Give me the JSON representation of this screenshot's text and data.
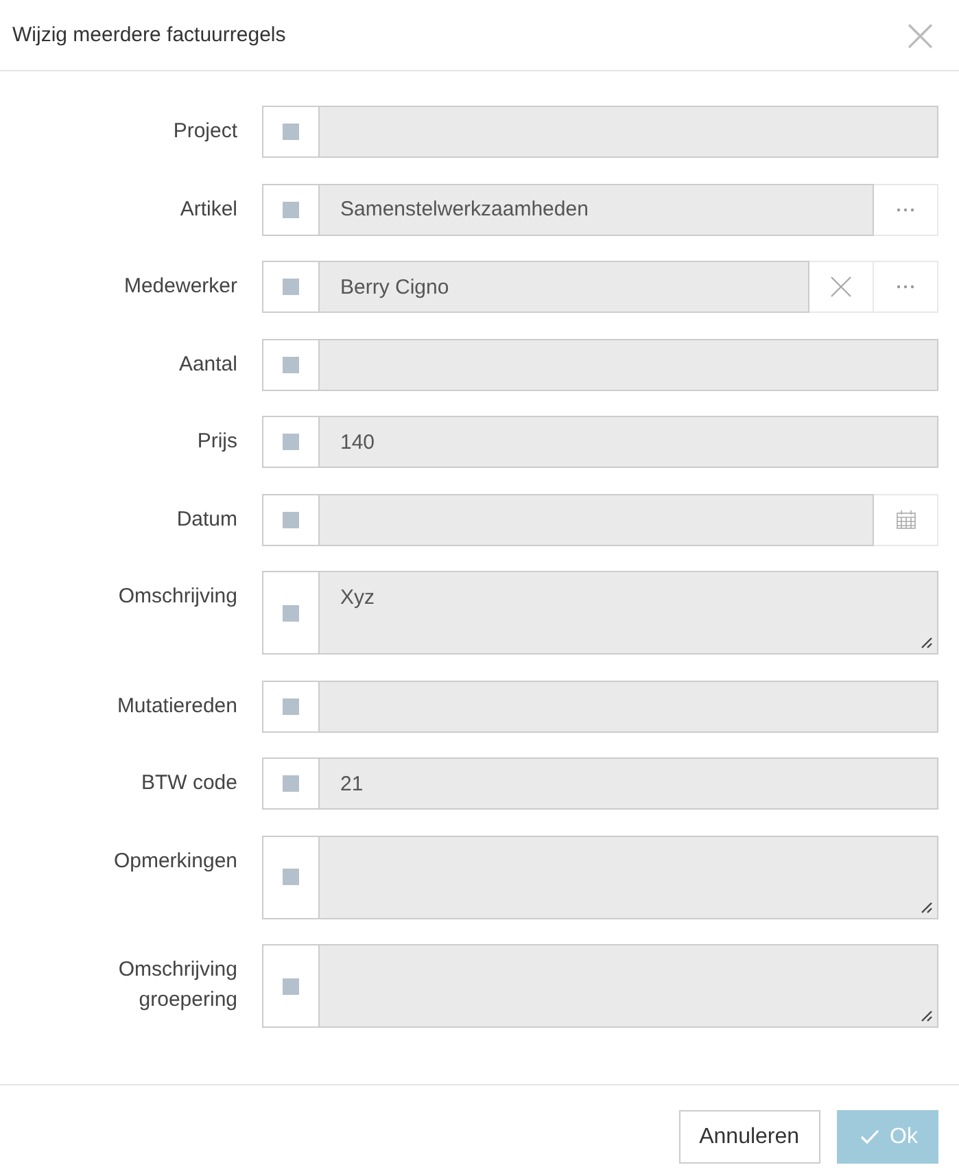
{
  "dialog": {
    "title": "Wijzig meerdere factuurregels",
    "close_symbol": "×"
  },
  "fields": [
    {
      "label": "Project",
      "kind": "text"
    },
    {
      "label": "Artikel",
      "kind": "lookup",
      "value": "Samenstelwerkzaamheden"
    },
    {
      "label": "Medewerker",
      "kind": "lookup_clearable",
      "value": "Berry Cigno"
    },
    {
      "label": "Aantal",
      "kind": "text"
    },
    {
      "label": "Prijs",
      "kind": "text",
      "value": "140"
    },
    {
      "label": "Datum",
      "kind": "date"
    },
    {
      "label": "Omschrijving",
      "kind": "textarea",
      "value": "Xyz"
    },
    {
      "label": "Mutatiereden",
      "kind": "text"
    },
    {
      "label": "BTW code",
      "kind": "text",
      "value": "21"
    },
    {
      "label": "Opmerkingen",
      "kind": "textarea"
    },
    {
      "label": "Omschrijving groepering",
      "kind": "textarea"
    }
  ],
  "buttons": [
    {
      "label": "Annuleren",
      "kind": "secondary"
    },
    {
      "label": "Ok",
      "kind": "primary"
    }
  ]
}
